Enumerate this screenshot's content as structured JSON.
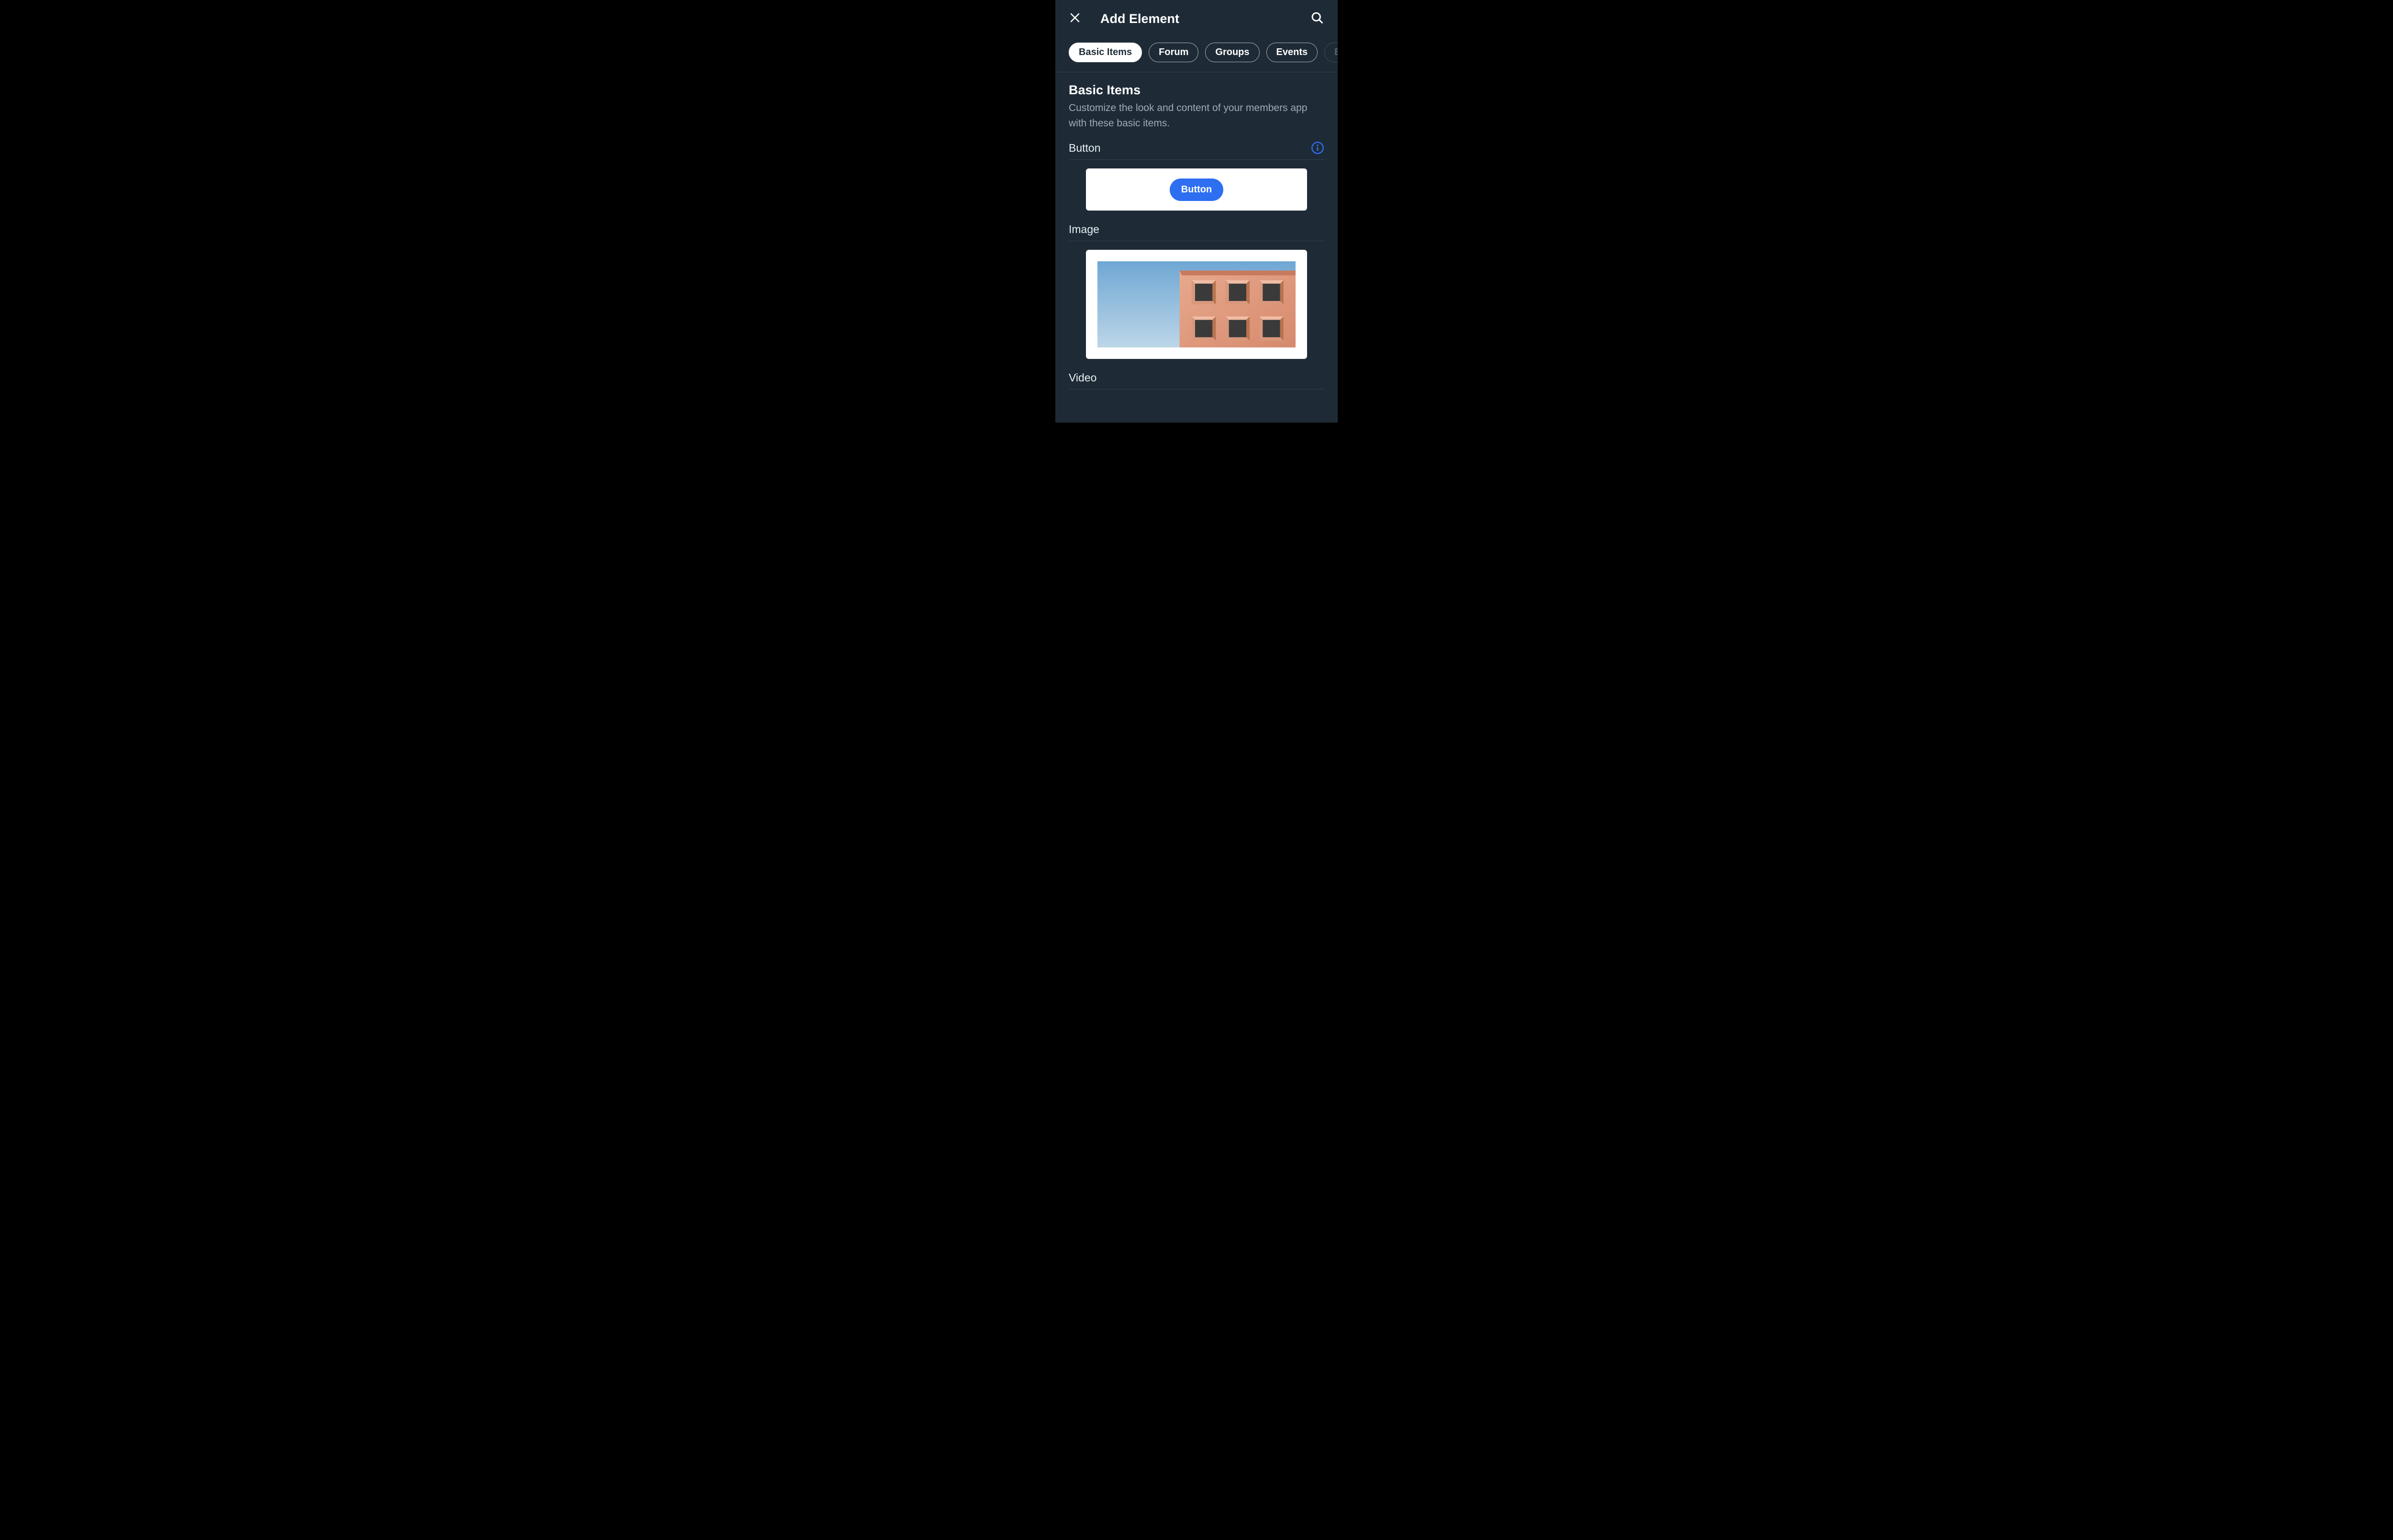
{
  "header": {
    "title": "Add Element"
  },
  "tabs": [
    {
      "label": "Basic Items",
      "active": true
    },
    {
      "label": "Forum",
      "active": false
    },
    {
      "label": "Groups",
      "active": false
    },
    {
      "label": "Events",
      "active": false
    },
    {
      "label": "Blog",
      "active": false,
      "overflow": true
    }
  ],
  "section": {
    "title": "Basic Items",
    "description": "Customize the look and content of your members app with these basic items."
  },
  "items": {
    "button": {
      "label": "Button",
      "sample_button_text": "Button"
    },
    "image": {
      "label": "Image"
    },
    "video": {
      "label": "Video"
    }
  },
  "colors": {
    "accent": "#2e6ff2",
    "info_ring": "#2e6ff2"
  }
}
